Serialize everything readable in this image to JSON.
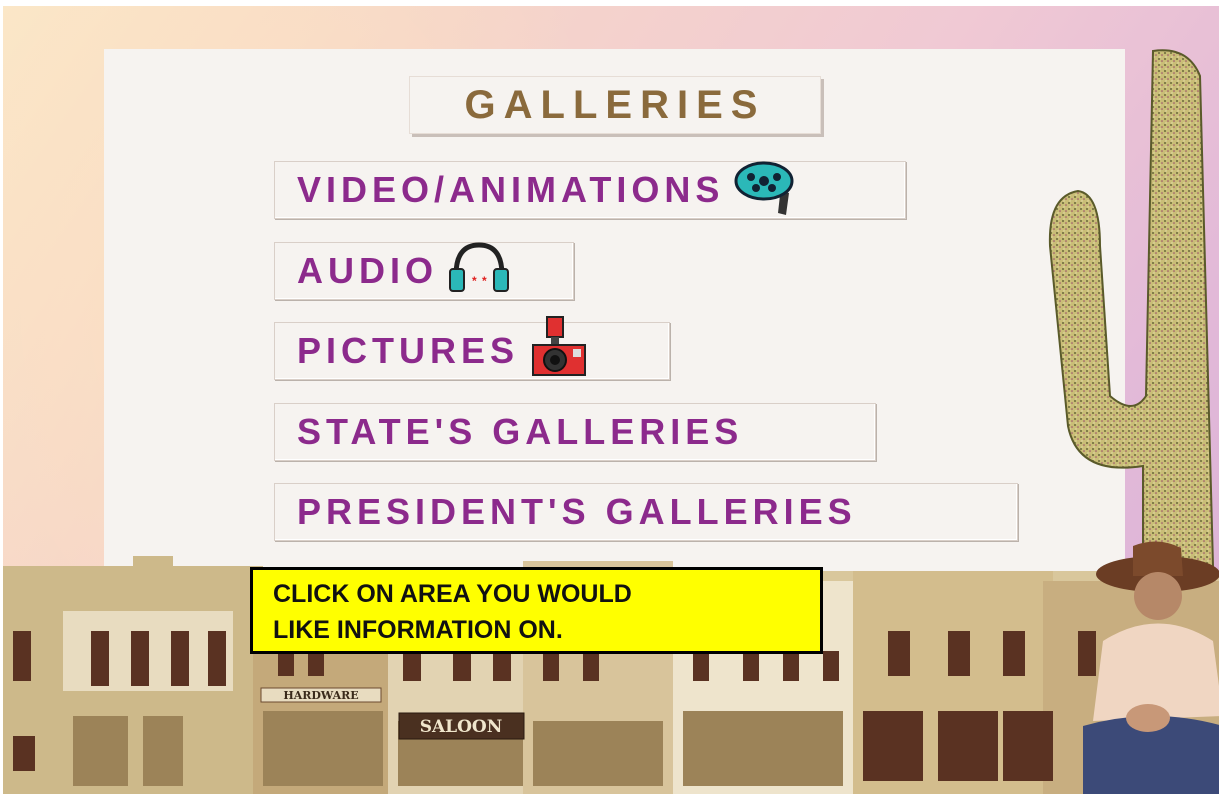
{
  "title": "GALLERIES",
  "menu": {
    "video": {
      "label": "VIDEO/ANIMATIONS",
      "icon": "film-reel-icon"
    },
    "audio": {
      "label": "AUDIO",
      "icon": "headphones-icon"
    },
    "pictures": {
      "label": "PICTURES",
      "icon": "camera-icon"
    },
    "states": {
      "label": "STATE'S GALLERIES"
    },
    "presidents": {
      "label": "PRESIDENT'S GALLERIES"
    }
  },
  "tooltip": {
    "line1": "CLICK ON AREA YOU WOULD",
    "line2": "LIKE INFORMATION ON."
  },
  "town": {
    "sign_hardware": "HARDWARE",
    "sign_saloon": "SALOON"
  },
  "colors": {
    "menu_text": "#8c2a8c",
    "title_text": "#8a6a3c",
    "tooltip_bg": "#ffff00"
  }
}
